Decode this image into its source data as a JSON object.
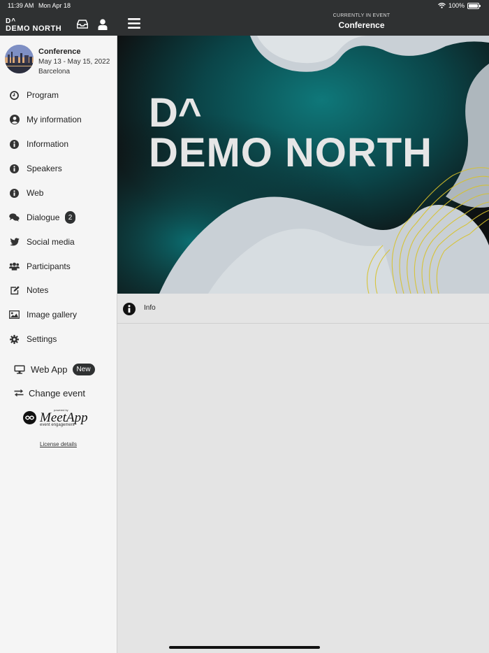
{
  "status": {
    "time": "11:39 AM",
    "date": "Mon Apr 18",
    "battery": "100%"
  },
  "header": {
    "logo_line1": "D^",
    "logo_line2": "DEMO NORTH",
    "currently_label": "CURRENTLY IN EVENT",
    "current_event": "Conference"
  },
  "event": {
    "name": "Conference",
    "dates": "May 13 - May 15, 2022",
    "city": "Barcelona"
  },
  "nav": [
    {
      "label": "Program",
      "icon": "clock-icon"
    },
    {
      "label": "My information",
      "icon": "user-circle-icon"
    },
    {
      "label": "Information",
      "icon": "info-icon"
    },
    {
      "label": "Speakers",
      "icon": "info-icon"
    },
    {
      "label": "Web",
      "icon": "info-icon"
    },
    {
      "label": "Dialogue",
      "icon": "chat-icon",
      "badge": "2"
    },
    {
      "label": "Social media",
      "icon": "twitter-icon"
    },
    {
      "label": "Participants",
      "icon": "users-icon"
    },
    {
      "label": "Notes",
      "icon": "edit-icon"
    },
    {
      "label": "Image gallery",
      "icon": "image-icon"
    },
    {
      "label": "Settings",
      "icon": "gear-icon"
    }
  ],
  "webapp": {
    "label": "Web App",
    "badge": "New"
  },
  "change_event": {
    "label": "Change event"
  },
  "powered": {
    "tiny": "powered by",
    "brand": "MeetApp",
    "sub": "event engagement"
  },
  "license": "License details",
  "hero": {
    "line1": "D^",
    "line2": "DEMO NORTH",
    "accent": "#0f8a8c",
    "wave": "#c9d0d6",
    "gold": "#d8c22a"
  },
  "info_row": {
    "label": "Info"
  }
}
